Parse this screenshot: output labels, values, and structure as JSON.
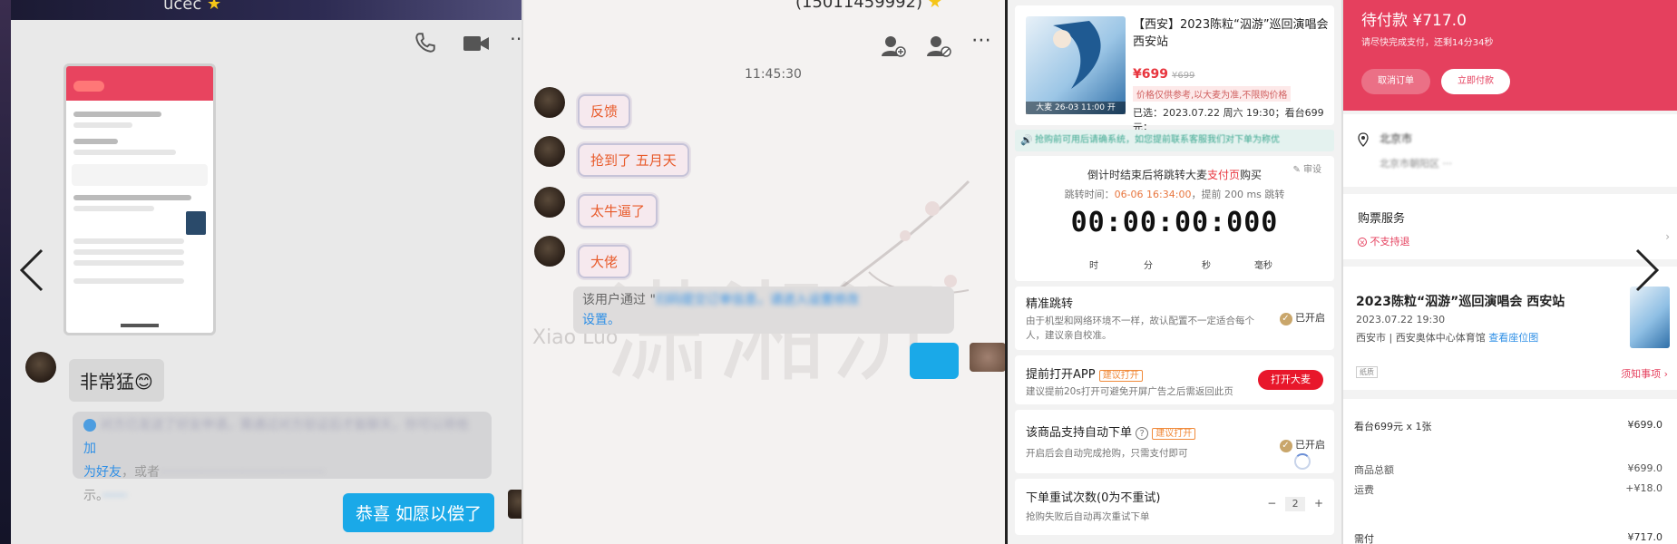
{
  "chat_a": {
    "title": "ucec",
    "title_star": "★",
    "phone_icon": "phone-icon",
    "video_icon": "video-icon",
    "more_icon": "more-icon",
    "msg_received": "非常猛😊",
    "system_notice": {
      "text1": "你已",
      "link1": "加",
      "link1b": "为好友",
      "text2": "，或者",
      "text3": "示。",
      "blurred": "对方已发送了好友申请，需通过对方验证后才能聊天，你可以将他"
    },
    "msg_sent": "恭喜 如愿以偿了"
  },
  "chat_b": {
    "title": "(15011459992)",
    "title_star": "★",
    "time": "11:45:30",
    "stickers": [
      "反馈",
      "抢到了 五月天",
      "太牛逼了",
      "大佬"
    ],
    "system": {
      "prefix": "该用户通过 \"",
      "blurred": "扫码提交订单信息，请进入设置修改",
      "link": "设置。"
    },
    "watermark": "潇湘沉",
    "watermark_latin": "Xiao  Luo"
  },
  "order_helper": {
    "poster_tag": "大麦 26-03 11:00 开",
    "event_title": "【西安】2023陈粒“泅游”巡回演唱会 西安站",
    "price": "¥699",
    "old_price": "¥699",
    "price_note": "价格仅供参考,以大麦为准,不限购价格",
    "selected": "已选：2023.07.22 周六 19:30；看台699元；",
    "notice": "抢购前可用后请确系统，如您提前联系客服我们对下单为称优",
    "countdown_title_a": "倒计时结束后将跳转大麦",
    "countdown_title_link": "支付页",
    "countdown_title_b": "购买",
    "feedback": "✎ 审设",
    "jump_time_label": "跳转时间：",
    "jump_time": "06-06 16:34:00",
    "jump_time_suffix": "，提前 200 ms 跳转",
    "clock": "00:00:00:000",
    "clock_units": [
      "时",
      "分",
      "秒",
      "毫秒"
    ],
    "precise_jump": {
      "title": "精准跳转",
      "desc": "由于机型和网络环境不一样，故认配置不一定适合每个人，建议亲自校准。",
      "status": "已开启"
    },
    "open_app": {
      "title": "提前打开APP",
      "badge": "建议打开",
      "desc": "建议提前20s打开可避免开屏广告之后需返回此页",
      "button": "打开大麦"
    },
    "auto_order": {
      "title": "该商品支持自动下单",
      "badge": "建议打开",
      "desc": "开启后会自动完成抢购，只需支付即可",
      "status": "已开启"
    },
    "retry": {
      "title": "下单重试次数(0为不重试)",
      "desc": "抢购失败后自动再次重试下单",
      "minus": "−",
      "value": "2",
      "plus": "+"
    }
  },
  "payment": {
    "status": "待付款 ¥717.0",
    "hint": "请尽快完成支付，还剩14分34秒",
    "cancel_label": "取消订单",
    "pay_label": "立即付款",
    "address_line1": "北京市",
    "address_line2": "北京市朝阳区 ···",
    "service_title": "购票服务",
    "service_item": "不支持退",
    "event_title": "2023陈粒“泅游”巡回演唱会 西安站",
    "event_time": "2023.07.22 19:30",
    "venue": "西安市 | 西安奥体中心体育馆",
    "venue_link": "查看座位图",
    "notice_link": "须知事项",
    "ticket_tag": "纸质",
    "rows": [
      {
        "label": "看台699元 x 1张",
        "value": "¥699.0"
      },
      {
        "label": "商品总额",
        "value": "¥699.0"
      },
      {
        "label": "运费",
        "value": "+¥18.0"
      },
      {
        "label": "需付",
        "value": "¥717.0"
      }
    ]
  },
  "colors": {
    "wechat_blue": "#1aa9e8",
    "damai_red": "#e5405e",
    "gold_check": "#c9a66b",
    "open_red": "#e8172b"
  }
}
